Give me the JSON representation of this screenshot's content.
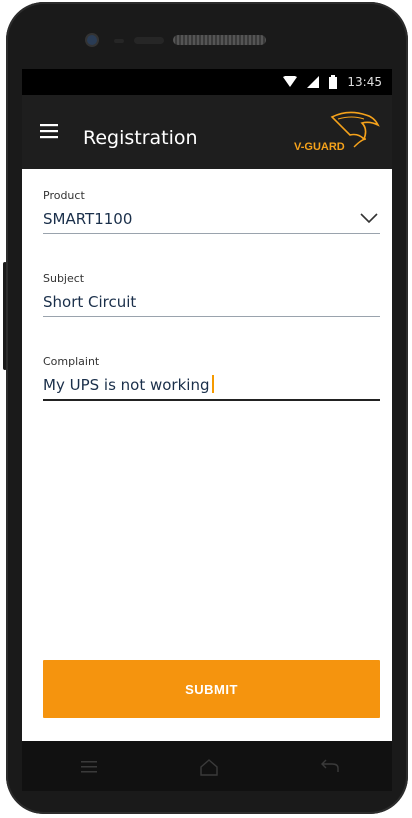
{
  "status_bar": {
    "time": "13:45"
  },
  "app_bar": {
    "title": "Registration",
    "logo_text": "V-GUARD"
  },
  "form": {
    "product": {
      "label": "Product",
      "value": "SMART1100"
    },
    "subject": {
      "label": "Subject",
      "value": "Short Circuit"
    },
    "complaint": {
      "label": "Complaint",
      "value": "My UPS is not working"
    }
  },
  "submit_label": "SUBMIT",
  "icons": {
    "menu": "hamburger-menu-icon",
    "dropdown": "chevron-down-icon",
    "nav": [
      "recents-icon",
      "home-icon",
      "back-icon"
    ]
  },
  "colors": {
    "accent": "#f5940e",
    "app_bar": "#1e1e1e",
    "text_value": "#1a2f4a"
  }
}
